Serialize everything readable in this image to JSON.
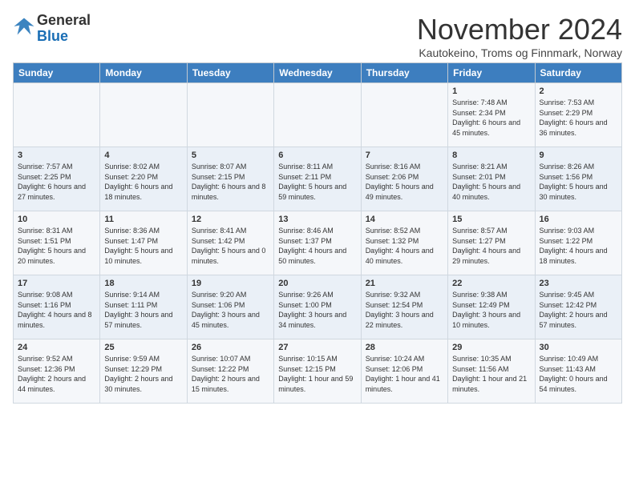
{
  "logo": {
    "text_general": "General",
    "text_blue": "Blue"
  },
  "header": {
    "month_year": "November 2024",
    "location": "Kautokeino, Troms og Finnmark, Norway"
  },
  "weekdays": [
    "Sunday",
    "Monday",
    "Tuesday",
    "Wednesday",
    "Thursday",
    "Friday",
    "Saturday"
  ],
  "weeks": [
    [
      {
        "day": "",
        "info": ""
      },
      {
        "day": "",
        "info": ""
      },
      {
        "day": "",
        "info": ""
      },
      {
        "day": "",
        "info": ""
      },
      {
        "day": "",
        "info": ""
      },
      {
        "day": "1",
        "info": "Sunrise: 7:48 AM\nSunset: 2:34 PM\nDaylight: 6 hours and 45 minutes."
      },
      {
        "day": "2",
        "info": "Sunrise: 7:53 AM\nSunset: 2:29 PM\nDaylight: 6 hours and 36 minutes."
      }
    ],
    [
      {
        "day": "3",
        "info": "Sunrise: 7:57 AM\nSunset: 2:25 PM\nDaylight: 6 hours and 27 minutes."
      },
      {
        "day": "4",
        "info": "Sunrise: 8:02 AM\nSunset: 2:20 PM\nDaylight: 6 hours and 18 minutes."
      },
      {
        "day": "5",
        "info": "Sunrise: 8:07 AM\nSunset: 2:15 PM\nDaylight: 6 hours and 8 minutes."
      },
      {
        "day": "6",
        "info": "Sunrise: 8:11 AM\nSunset: 2:11 PM\nDaylight: 5 hours and 59 minutes."
      },
      {
        "day": "7",
        "info": "Sunrise: 8:16 AM\nSunset: 2:06 PM\nDaylight: 5 hours and 49 minutes."
      },
      {
        "day": "8",
        "info": "Sunrise: 8:21 AM\nSunset: 2:01 PM\nDaylight: 5 hours and 40 minutes."
      },
      {
        "day": "9",
        "info": "Sunrise: 8:26 AM\nSunset: 1:56 PM\nDaylight: 5 hours and 30 minutes."
      }
    ],
    [
      {
        "day": "10",
        "info": "Sunrise: 8:31 AM\nSunset: 1:51 PM\nDaylight: 5 hours and 20 minutes."
      },
      {
        "day": "11",
        "info": "Sunrise: 8:36 AM\nSunset: 1:47 PM\nDaylight: 5 hours and 10 minutes."
      },
      {
        "day": "12",
        "info": "Sunrise: 8:41 AM\nSunset: 1:42 PM\nDaylight: 5 hours and 0 minutes."
      },
      {
        "day": "13",
        "info": "Sunrise: 8:46 AM\nSunset: 1:37 PM\nDaylight: 4 hours and 50 minutes."
      },
      {
        "day": "14",
        "info": "Sunrise: 8:52 AM\nSunset: 1:32 PM\nDaylight: 4 hours and 40 minutes."
      },
      {
        "day": "15",
        "info": "Sunrise: 8:57 AM\nSunset: 1:27 PM\nDaylight: 4 hours and 29 minutes."
      },
      {
        "day": "16",
        "info": "Sunrise: 9:03 AM\nSunset: 1:22 PM\nDaylight: 4 hours and 18 minutes."
      }
    ],
    [
      {
        "day": "17",
        "info": "Sunrise: 9:08 AM\nSunset: 1:16 PM\nDaylight: 4 hours and 8 minutes."
      },
      {
        "day": "18",
        "info": "Sunrise: 9:14 AM\nSunset: 1:11 PM\nDaylight: 3 hours and 57 minutes."
      },
      {
        "day": "19",
        "info": "Sunrise: 9:20 AM\nSunset: 1:06 PM\nDaylight: 3 hours and 45 minutes."
      },
      {
        "day": "20",
        "info": "Sunrise: 9:26 AM\nSunset: 1:00 PM\nDaylight: 3 hours and 34 minutes."
      },
      {
        "day": "21",
        "info": "Sunrise: 9:32 AM\nSunset: 12:54 PM\nDaylight: 3 hours and 22 minutes."
      },
      {
        "day": "22",
        "info": "Sunrise: 9:38 AM\nSunset: 12:49 PM\nDaylight: 3 hours and 10 minutes."
      },
      {
        "day": "23",
        "info": "Sunrise: 9:45 AM\nSunset: 12:42 PM\nDaylight: 2 hours and 57 minutes."
      }
    ],
    [
      {
        "day": "24",
        "info": "Sunrise: 9:52 AM\nSunset: 12:36 PM\nDaylight: 2 hours and 44 minutes."
      },
      {
        "day": "25",
        "info": "Sunrise: 9:59 AM\nSunset: 12:29 PM\nDaylight: 2 hours and 30 minutes."
      },
      {
        "day": "26",
        "info": "Sunrise: 10:07 AM\nSunset: 12:22 PM\nDaylight: 2 hours and 15 minutes."
      },
      {
        "day": "27",
        "info": "Sunrise: 10:15 AM\nSunset: 12:15 PM\nDaylight: 1 hour and 59 minutes."
      },
      {
        "day": "28",
        "info": "Sunrise: 10:24 AM\nSunset: 12:06 PM\nDaylight: 1 hour and 41 minutes."
      },
      {
        "day": "29",
        "info": "Sunrise: 10:35 AM\nSunset: 11:56 AM\nDaylight: 1 hour and 21 minutes."
      },
      {
        "day": "30",
        "info": "Sunrise: 10:49 AM\nSunset: 11:43 AM\nDaylight: 0 hours and 54 minutes."
      }
    ]
  ]
}
